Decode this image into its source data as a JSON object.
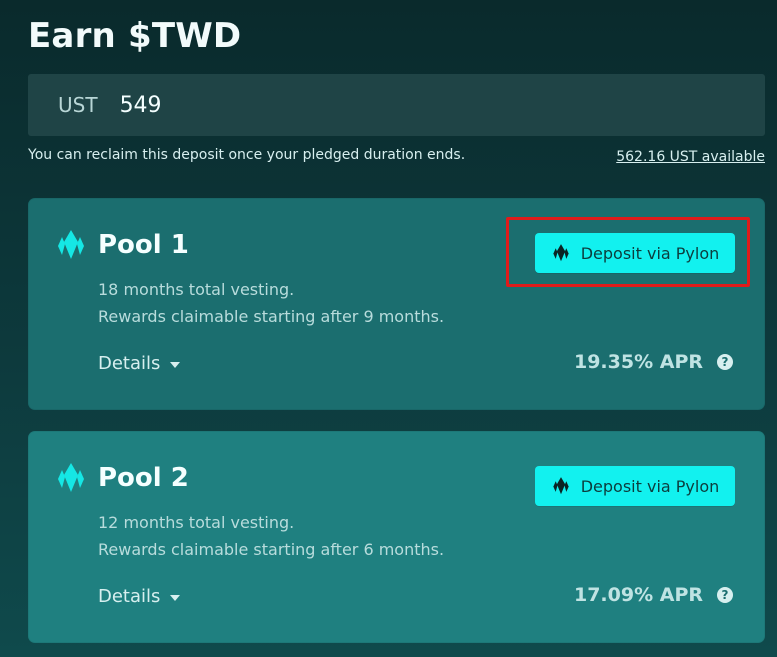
{
  "header": {
    "title": "Earn $TWD"
  },
  "deposit_input": {
    "currency": "UST",
    "value": "549"
  },
  "notes": {
    "reclaim": "You can reclaim this deposit once your pledged duration ends.",
    "available": "562.16 UST available"
  },
  "pools": [
    {
      "name": "Pool 1",
      "vesting": "18 months total vesting.",
      "rewards": "Rewards claimable starting after 9 months.",
      "details_label": "Details",
      "apr": "19.35% APR",
      "button_label": "Deposit via Pylon"
    },
    {
      "name": "Pool 2",
      "vesting": "12 months total vesting.",
      "rewards": "Rewards claimable starting after 6 months.",
      "details_label": "Details",
      "apr": "17.09% APR",
      "button_label": "Deposit via Pylon"
    }
  ],
  "ui": {
    "help_icon_label": "?"
  },
  "colors": {
    "accent": "#12f1ef",
    "highlight": "#e01b1b"
  },
  "icons": {
    "pool": "pylon-icon",
    "button": "pylon-icon",
    "details": "caret-down-icon",
    "help": "question-icon"
  }
}
